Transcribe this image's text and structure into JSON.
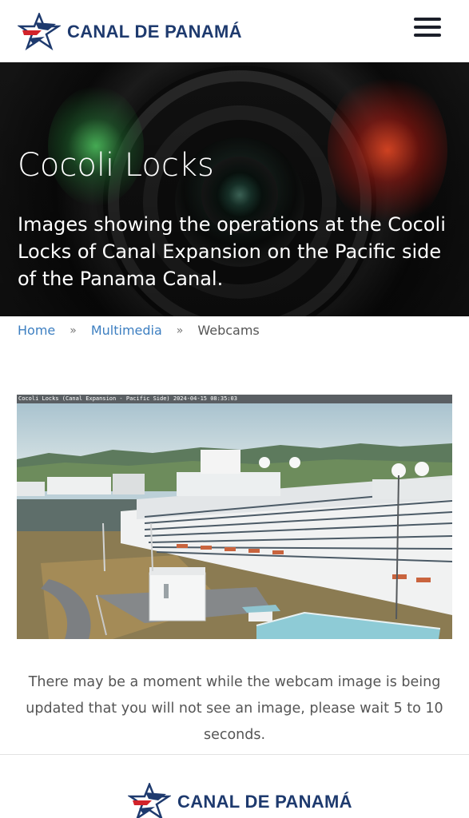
{
  "header": {
    "brand": {
      "part1": "Canal de ",
      "part2": "Panamá"
    },
    "menu_icon": "hamburger-menu-icon"
  },
  "hero": {
    "title": "Cocoli Locks",
    "description": "Images showing the operations at the Cocoli Locks of Canal Expansion on the Pacific side of the Panama Canal."
  },
  "breadcrumb": {
    "items": [
      "Home",
      "Multimedia",
      "Webcams"
    ],
    "separator": "»"
  },
  "webcam": {
    "caption": "Cocoli Locks (Canal Expansion - Pacific Side) 2024-04-15 08:35:03"
  },
  "note": "There may be a moment while the webcam image is being updated that you will not see an image, please wait 5 to 10 seconds.",
  "footer": {
    "brand": {
      "part1": "Canal de ",
      "part2": "Panamá"
    }
  },
  "colors": {
    "brand_navy": "#1e3a6e",
    "brand_red": "#d2232a",
    "link": "#3d7fc1"
  }
}
